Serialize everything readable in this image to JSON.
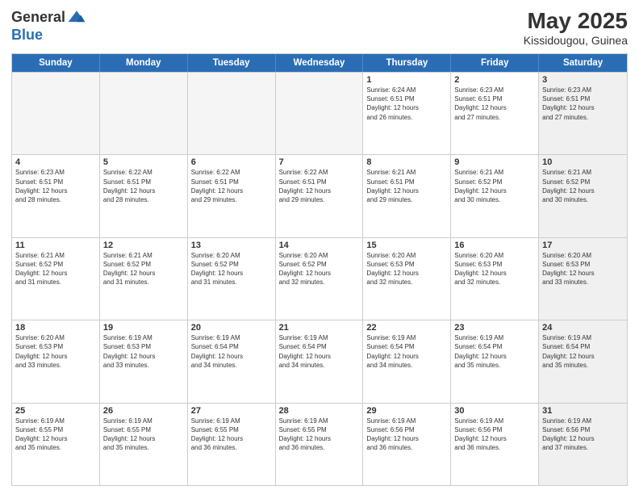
{
  "header": {
    "logo_general": "General",
    "logo_blue": "Blue",
    "month_title": "May 2025",
    "subtitle": "Kissidougou, Guinea"
  },
  "calendar": {
    "days_of_week": [
      "Sunday",
      "Monday",
      "Tuesday",
      "Wednesday",
      "Thursday",
      "Friday",
      "Saturday"
    ],
    "weeks": [
      [
        {
          "day": "",
          "info": "",
          "empty": true
        },
        {
          "day": "",
          "info": "",
          "empty": true
        },
        {
          "day": "",
          "info": "",
          "empty": true
        },
        {
          "day": "",
          "info": "",
          "empty": true
        },
        {
          "day": "1",
          "info": "Sunrise: 6:24 AM\nSunset: 6:51 PM\nDaylight: 12 hours\nand 26 minutes.",
          "empty": false
        },
        {
          "day": "2",
          "info": "Sunrise: 6:23 AM\nSunset: 6:51 PM\nDaylight: 12 hours\nand 27 minutes.",
          "empty": false
        },
        {
          "day": "3",
          "info": "Sunrise: 6:23 AM\nSunset: 6:51 PM\nDaylight: 12 hours\nand 27 minutes.",
          "empty": false,
          "shaded": true
        }
      ],
      [
        {
          "day": "4",
          "info": "Sunrise: 6:23 AM\nSunset: 6:51 PM\nDaylight: 12 hours\nand 28 minutes.",
          "empty": false
        },
        {
          "day": "5",
          "info": "Sunrise: 6:22 AM\nSunset: 6:51 PM\nDaylight: 12 hours\nand 28 minutes.",
          "empty": false
        },
        {
          "day": "6",
          "info": "Sunrise: 6:22 AM\nSunset: 6:51 PM\nDaylight: 12 hours\nand 29 minutes.",
          "empty": false
        },
        {
          "day": "7",
          "info": "Sunrise: 6:22 AM\nSunset: 6:51 PM\nDaylight: 12 hours\nand 29 minutes.",
          "empty": false
        },
        {
          "day": "8",
          "info": "Sunrise: 6:21 AM\nSunset: 6:51 PM\nDaylight: 12 hours\nand 29 minutes.",
          "empty": false
        },
        {
          "day": "9",
          "info": "Sunrise: 6:21 AM\nSunset: 6:52 PM\nDaylight: 12 hours\nand 30 minutes.",
          "empty": false
        },
        {
          "day": "10",
          "info": "Sunrise: 6:21 AM\nSunset: 6:52 PM\nDaylight: 12 hours\nand 30 minutes.",
          "empty": false,
          "shaded": true
        }
      ],
      [
        {
          "day": "11",
          "info": "Sunrise: 6:21 AM\nSunset: 6:52 PM\nDaylight: 12 hours\nand 31 minutes.",
          "empty": false
        },
        {
          "day": "12",
          "info": "Sunrise: 6:21 AM\nSunset: 6:52 PM\nDaylight: 12 hours\nand 31 minutes.",
          "empty": false
        },
        {
          "day": "13",
          "info": "Sunrise: 6:20 AM\nSunset: 6:52 PM\nDaylight: 12 hours\nand 31 minutes.",
          "empty": false
        },
        {
          "day": "14",
          "info": "Sunrise: 6:20 AM\nSunset: 6:52 PM\nDaylight: 12 hours\nand 32 minutes.",
          "empty": false
        },
        {
          "day": "15",
          "info": "Sunrise: 6:20 AM\nSunset: 6:53 PM\nDaylight: 12 hours\nand 32 minutes.",
          "empty": false
        },
        {
          "day": "16",
          "info": "Sunrise: 6:20 AM\nSunset: 6:53 PM\nDaylight: 12 hours\nand 32 minutes.",
          "empty": false
        },
        {
          "day": "17",
          "info": "Sunrise: 6:20 AM\nSunset: 6:53 PM\nDaylight: 12 hours\nand 33 minutes.",
          "empty": false,
          "shaded": true
        }
      ],
      [
        {
          "day": "18",
          "info": "Sunrise: 6:20 AM\nSunset: 6:53 PM\nDaylight: 12 hours\nand 33 minutes.",
          "empty": false
        },
        {
          "day": "19",
          "info": "Sunrise: 6:19 AM\nSunset: 6:53 PM\nDaylight: 12 hours\nand 33 minutes.",
          "empty": false
        },
        {
          "day": "20",
          "info": "Sunrise: 6:19 AM\nSunset: 6:54 PM\nDaylight: 12 hours\nand 34 minutes.",
          "empty": false
        },
        {
          "day": "21",
          "info": "Sunrise: 6:19 AM\nSunset: 6:54 PM\nDaylight: 12 hours\nand 34 minutes.",
          "empty": false
        },
        {
          "day": "22",
          "info": "Sunrise: 6:19 AM\nSunset: 6:54 PM\nDaylight: 12 hours\nand 34 minutes.",
          "empty": false
        },
        {
          "day": "23",
          "info": "Sunrise: 6:19 AM\nSunset: 6:54 PM\nDaylight: 12 hours\nand 35 minutes.",
          "empty": false
        },
        {
          "day": "24",
          "info": "Sunrise: 6:19 AM\nSunset: 6:54 PM\nDaylight: 12 hours\nand 35 minutes.",
          "empty": false,
          "shaded": true
        }
      ],
      [
        {
          "day": "25",
          "info": "Sunrise: 6:19 AM\nSunset: 6:55 PM\nDaylight: 12 hours\nand 35 minutes.",
          "empty": false
        },
        {
          "day": "26",
          "info": "Sunrise: 6:19 AM\nSunset: 6:55 PM\nDaylight: 12 hours\nand 35 minutes.",
          "empty": false
        },
        {
          "day": "27",
          "info": "Sunrise: 6:19 AM\nSunset: 6:55 PM\nDaylight: 12 hours\nand 36 minutes.",
          "empty": false
        },
        {
          "day": "28",
          "info": "Sunrise: 6:19 AM\nSunset: 6:55 PM\nDaylight: 12 hours\nand 36 minutes.",
          "empty": false
        },
        {
          "day": "29",
          "info": "Sunrise: 6:19 AM\nSunset: 6:56 PM\nDaylight: 12 hours\nand 36 minutes.",
          "empty": false
        },
        {
          "day": "30",
          "info": "Sunrise: 6:19 AM\nSunset: 6:56 PM\nDaylight: 12 hours\nand 36 minutes.",
          "empty": false
        },
        {
          "day": "31",
          "info": "Sunrise: 6:19 AM\nSunset: 6:56 PM\nDaylight: 12 hours\nand 37 minutes.",
          "empty": false,
          "shaded": true
        }
      ]
    ]
  }
}
